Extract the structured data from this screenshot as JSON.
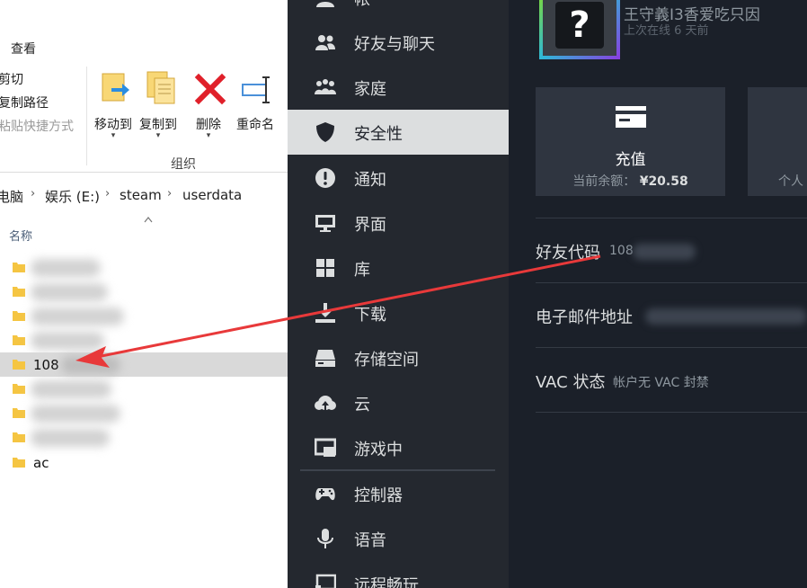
{
  "explorer": {
    "ribbon_tab": "查看",
    "clipboard": {
      "cut": "剪切",
      "copy_path": "复制路径",
      "paste_shortcut": "粘贴快捷方式"
    },
    "organize": {
      "move_to": "移动到",
      "copy_to": "复制到",
      "delete": "删除",
      "rename": "重命名",
      "group_label": "组织"
    },
    "address": {
      "segments": [
        "电脑",
        "娱乐 (E:)",
        "steam",
        "userdata"
      ]
    },
    "column_name": "名称",
    "files": [
      {
        "name": ""
      },
      {
        "name": ""
      },
      {
        "name": ""
      },
      {
        "name": ""
      },
      {
        "name": "108",
        "selected": true
      },
      {
        "name": ""
      },
      {
        "name": ""
      },
      {
        "name": ""
      },
      {
        "name": "ac"
      }
    ]
  },
  "steam_nav": {
    "items": [
      {
        "label": "帐",
        "icon": "person-icon"
      },
      {
        "label": "好友与聊天",
        "icon": "friends-icon"
      },
      {
        "label": "家庭",
        "icon": "family-icon"
      },
      {
        "label": "安全性",
        "icon": "shield-icon",
        "active": true
      },
      {
        "label": "通知",
        "icon": "alert-icon"
      },
      {
        "label": "界面",
        "icon": "monitor-icon"
      },
      {
        "label": "库",
        "icon": "grid-icon"
      },
      {
        "label": "下载",
        "icon": "download-icon"
      },
      {
        "label": "存储空间",
        "icon": "storage-icon"
      },
      {
        "label": "云",
        "icon": "cloud-icon"
      },
      {
        "label": "游戏中",
        "icon": "ingame-icon"
      },
      {
        "label": "控制器",
        "icon": "controller-icon"
      },
      {
        "label": "语音",
        "icon": "microphone-icon"
      },
      {
        "label": "远程畅玩",
        "icon": "remote-play-icon"
      }
    ]
  },
  "profile": {
    "username": "王守義I3香爱吃只因",
    "last_online": "上次在线 6 天前"
  },
  "cards": {
    "wallet": {
      "title": "充值",
      "balance_label": "当前余额：",
      "balance_value": "¥20.58"
    },
    "second": {
      "sub_label": "个人"
    }
  },
  "info": {
    "friend_code": {
      "label": "好友代码",
      "value": "108"
    },
    "email": {
      "label": "电子邮件地址"
    },
    "vac": {
      "label": "VAC 状态",
      "value": "帐户无 VAC 封禁"
    }
  },
  "colors": {
    "steam_nav_bg": "#24282f",
    "steam_main_bg": "#1b2029",
    "active_item_bg": "#dcdedf",
    "annotation_arrow": "#e8393a",
    "delete_icon": "#e0202a"
  }
}
